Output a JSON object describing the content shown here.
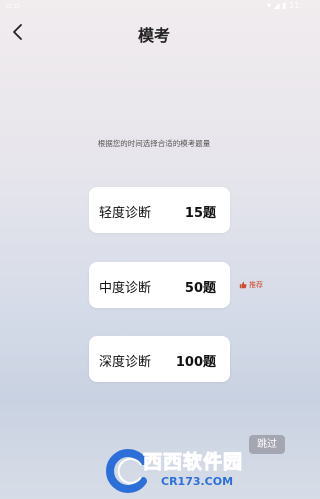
{
  "status_bar": {
    "left_text": "▫ ▫",
    "right_text": "▾ ◢ ▮ 11:"
  },
  "header": {
    "title": "模考"
  },
  "hint": "根据您的时间选择合适的模考题量",
  "options": [
    {
      "label": "轻度诊断",
      "count": "15题"
    },
    {
      "label": "中度诊断",
      "count": "50题"
    },
    {
      "label": "深度诊断",
      "count": "100题"
    }
  ],
  "recommend": {
    "icon": "thumbs-up-icon",
    "text": "推荐"
  },
  "skip_label": "跳过",
  "watermark": {
    "brand": "西西软件园",
    "domain": "CR173.COM"
  },
  "colors": {
    "recommend": "#cc4a2e",
    "watermark_orange": "#ff7a1a",
    "watermark_blue": "#2d6fd9"
  }
}
